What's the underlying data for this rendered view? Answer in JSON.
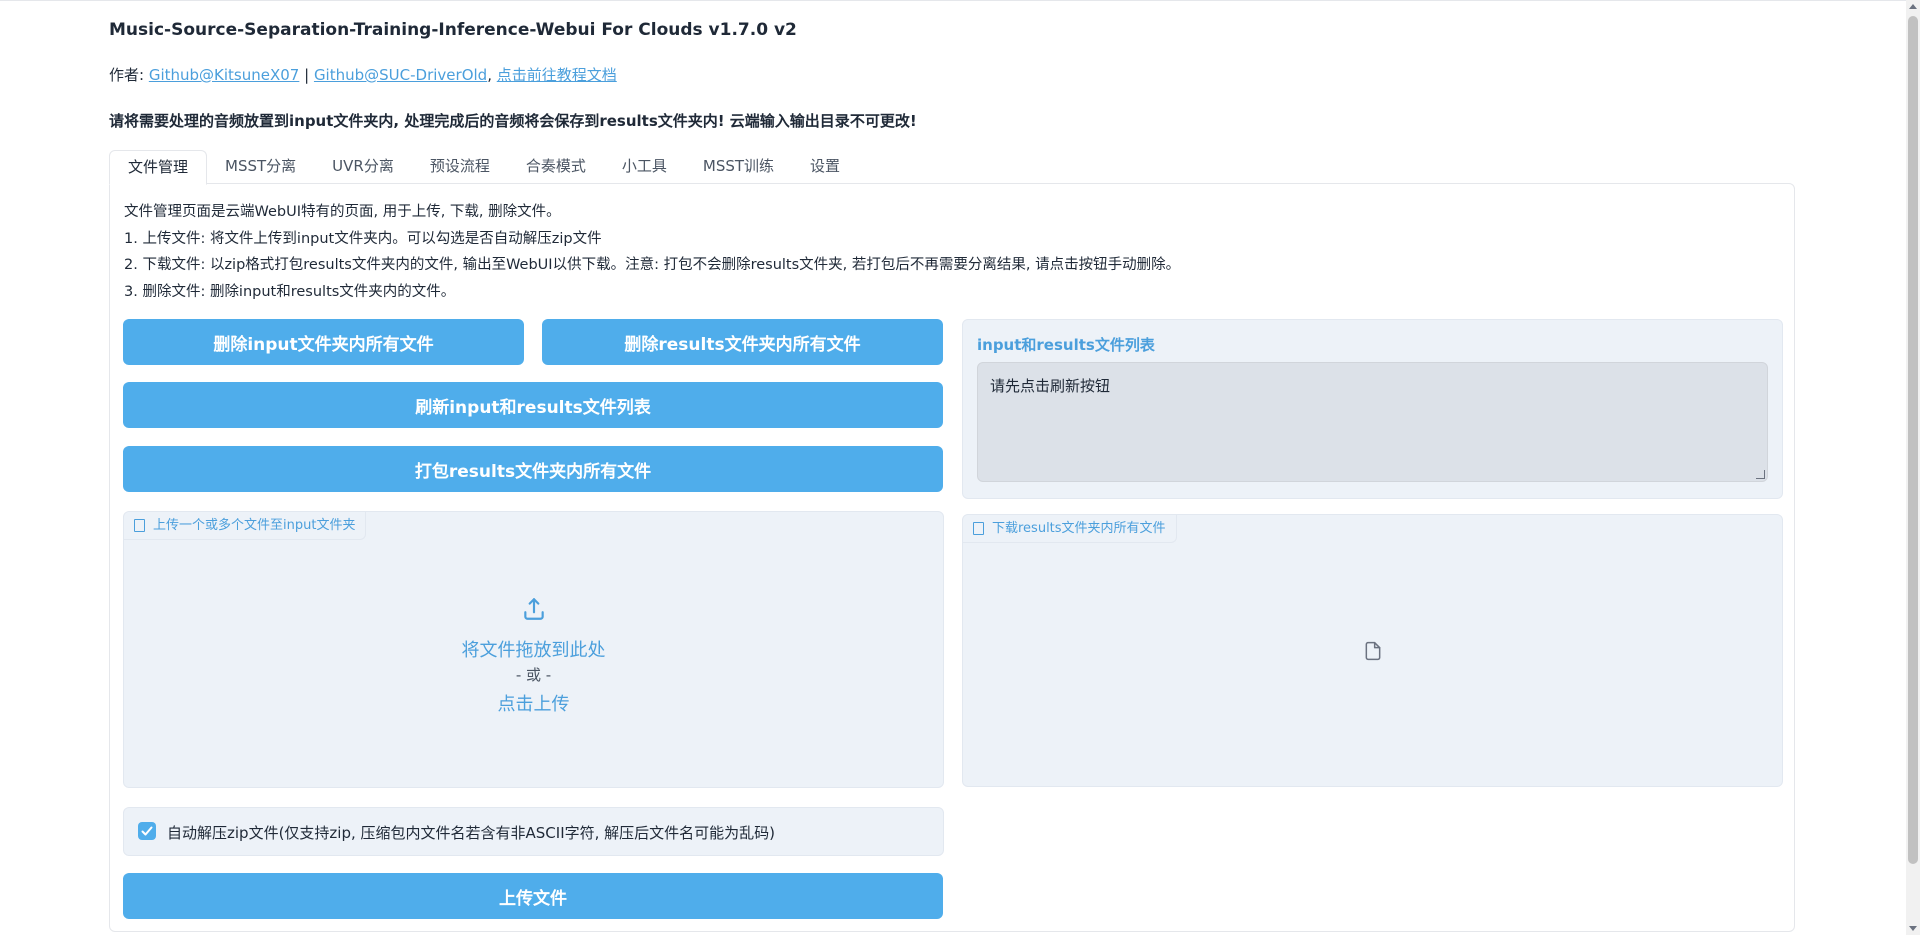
{
  "header": {
    "title": "Music-Source-Separation-Training-Inference-Webui For Clouds v1.7.0 v2",
    "author_prefix": "作者: ",
    "author1": "Github@KitsuneX07",
    "separator": " | ",
    "author2": "Github@SUC-DriverOld",
    "comma": ", ",
    "docs_link": "点击前往教程文档",
    "notice": "请将需要处理的音频放置到input文件夹内, 处理完成后的音频将会保存到results文件夹内! 云端输入输出目录不可更改!"
  },
  "tabs": [
    {
      "label": "文件管理",
      "active": true
    },
    {
      "label": "MSST分离",
      "active": false
    },
    {
      "label": "UVR分离",
      "active": false
    },
    {
      "label": "预设流程",
      "active": false
    },
    {
      "label": "合奏模式",
      "active": false
    },
    {
      "label": "小工具",
      "active": false
    },
    {
      "label": "MSST训练",
      "active": false
    },
    {
      "label": "设置",
      "active": false
    }
  ],
  "description": [
    "文件管理页面是云端WebUI特有的页面, 用于上传, 下载, 删除文件。",
    "1. 上传文件: 将文件上传到input文件夹内。可以勾选是否自动解压zip文件",
    "2. 下载文件: 以zip格式打包results文件夹内的文件, 输出至WebUI以供下载。注意: 打包不会删除results文件夹, 若打包后不再需要分离结果, 请点击按钮手动删除。",
    "3. 删除文件: 删除input和results文件夹内的文件。"
  ],
  "buttons": {
    "delete_input": "删除input文件夹内所有文件",
    "delete_results": "删除results文件夹内所有文件",
    "refresh": "刷新input和results文件列表",
    "pack": "打包results文件夹内所有文件",
    "upload": "上传文件"
  },
  "file_list": {
    "label": "input和results文件列表",
    "value": "请先点击刷新按钮"
  },
  "upload_box": {
    "label": "上传一个或多个文件至input文件夹",
    "drop_text": "将文件拖放到此处",
    "or_text": "- 或 -",
    "click_text": "点击上传"
  },
  "download_box": {
    "label": "下载results文件夹内所有文件"
  },
  "unzip_checkbox": {
    "label": "自动解压zip文件(仅支持zip, 压缩包内文件名若含有非ASCII字符, 解压后文件名可能为乱码)",
    "checked": true
  },
  "colors": {
    "accent": "#4fadeb",
    "link": "#4b9fdc",
    "block_bg": "#edf2f8"
  }
}
